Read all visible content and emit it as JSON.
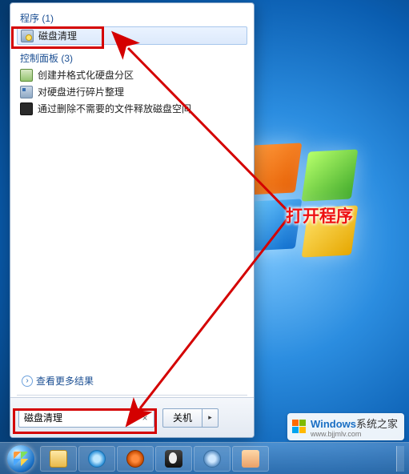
{
  "sections": {
    "programs_header": "程序 (1)",
    "control_panel_header": "控制面板 (3)"
  },
  "results": {
    "disk_cleanup": "磁盘清理",
    "control_panel": {
      "item1": "创建并格式化硬盘分区",
      "item2": "对硬盘进行碎片整理",
      "item3": "通过删除不需要的文件释放磁盘空间"
    }
  },
  "see_more": "查看更多结果",
  "search": {
    "value": "磁盘清理",
    "clear_symbol": "×"
  },
  "shutdown": {
    "label": "关机",
    "arrow": "▸"
  },
  "annotation": {
    "open_program": "打开程序"
  },
  "watermark": {
    "brand": "Windows",
    "site": "系统之家",
    "url": "www.bjjmlv.com"
  }
}
